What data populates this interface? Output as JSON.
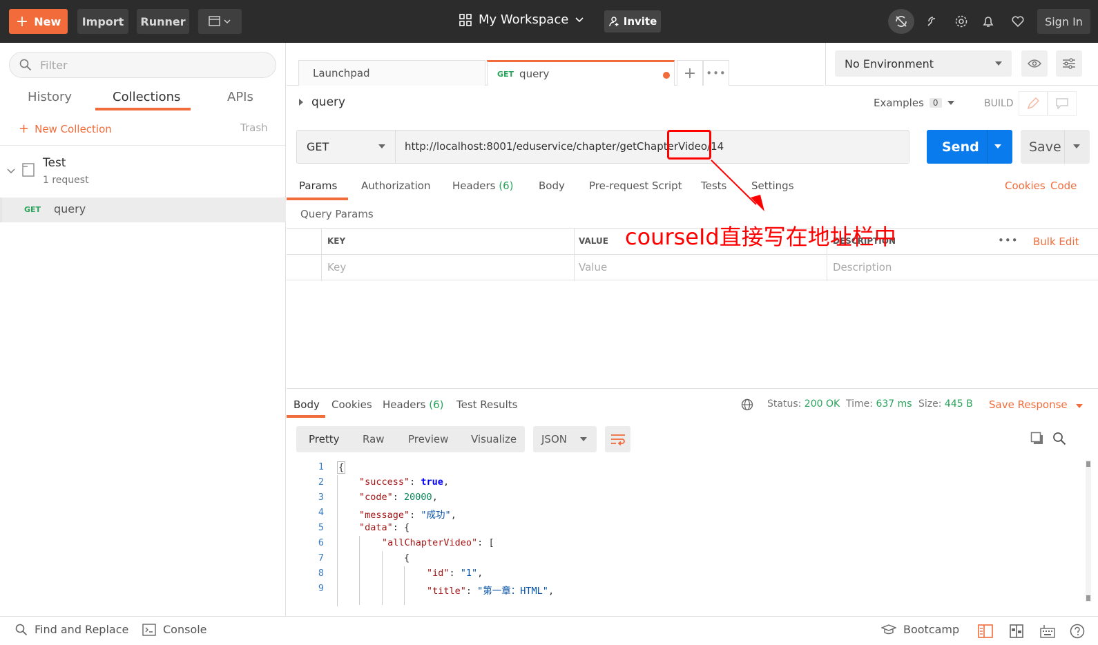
{
  "topbar": {
    "new": "New",
    "import": "Import",
    "runner": "Runner",
    "workspace": "My Workspace",
    "invite": "Invite",
    "signin": "Sign In"
  },
  "sidebar": {
    "filter_placeholder": "Filter",
    "tabs": [
      "History",
      "Collections",
      "APIs"
    ],
    "new_collection": "New Collection",
    "trash": "Trash",
    "collection": {
      "name": "Test",
      "count": "1 request"
    },
    "request": {
      "method": "GET",
      "name": "query"
    }
  },
  "tabs": {
    "launchpad": "Launchpad",
    "active_method": "GET",
    "active_name": "query"
  },
  "env": {
    "selected": "No Environment"
  },
  "request": {
    "title": "query",
    "examples_label": "Examples",
    "examples_count": "0",
    "build": "BUILD",
    "method": "GET",
    "url": "http://localhost:8001/eduservice/chapter/getChapterVideo/14",
    "send": "Send",
    "save": "Save"
  },
  "req_tabs": {
    "params": "Params",
    "authorization": "Authorization",
    "headers": "Headers",
    "headers_count": "(6)",
    "body": "Body",
    "prereq": "Pre-request Script",
    "tests": "Tests",
    "settings": "Settings",
    "cookies": "Cookies",
    "code": "Code"
  },
  "params": {
    "title": "Query Params",
    "key_h": "KEY",
    "value_h": "VALUE",
    "desc_h": "DESCRIPTION",
    "bulk": "Bulk Edit",
    "key_ph": "Key",
    "value_ph": "Value",
    "desc_ph": "Description"
  },
  "annotation": "courseId直接写在地址栏中",
  "response": {
    "tabs": [
      "Body",
      "Cookies",
      "Headers",
      "Test Results"
    ],
    "headers_count": "(6)",
    "status_label": "Status:",
    "status": "200 OK",
    "time_label": "Time:",
    "time": "637 ms",
    "size_label": "Size:",
    "size": "445 B",
    "save": "Save Response",
    "modes": [
      "Pretty",
      "Raw",
      "Preview",
      "Visualize"
    ],
    "format": "JSON"
  },
  "code_lines": [
    "1",
    "2",
    "3",
    "4",
    "5",
    "6",
    "7",
    "8",
    "9"
  ],
  "code": {
    "l1": "{",
    "k2": "\"success\"",
    "v2": "true",
    "k3": "\"code\"",
    "v3": "20000",
    "k4": "\"message\"",
    "v4": "\"成功\"",
    "k5": "\"data\"",
    "p5": "{",
    "k6": "\"allChapterVideo\"",
    "p6": "[",
    "l7": "{",
    "k8": "\"id\"",
    "v8": "\"1\"",
    "k9": "\"title\"",
    "v9": "\"第一章：HTML\""
  },
  "footer": {
    "find": "Find and Replace",
    "console": "Console",
    "bootcamp": "Bootcamp"
  }
}
